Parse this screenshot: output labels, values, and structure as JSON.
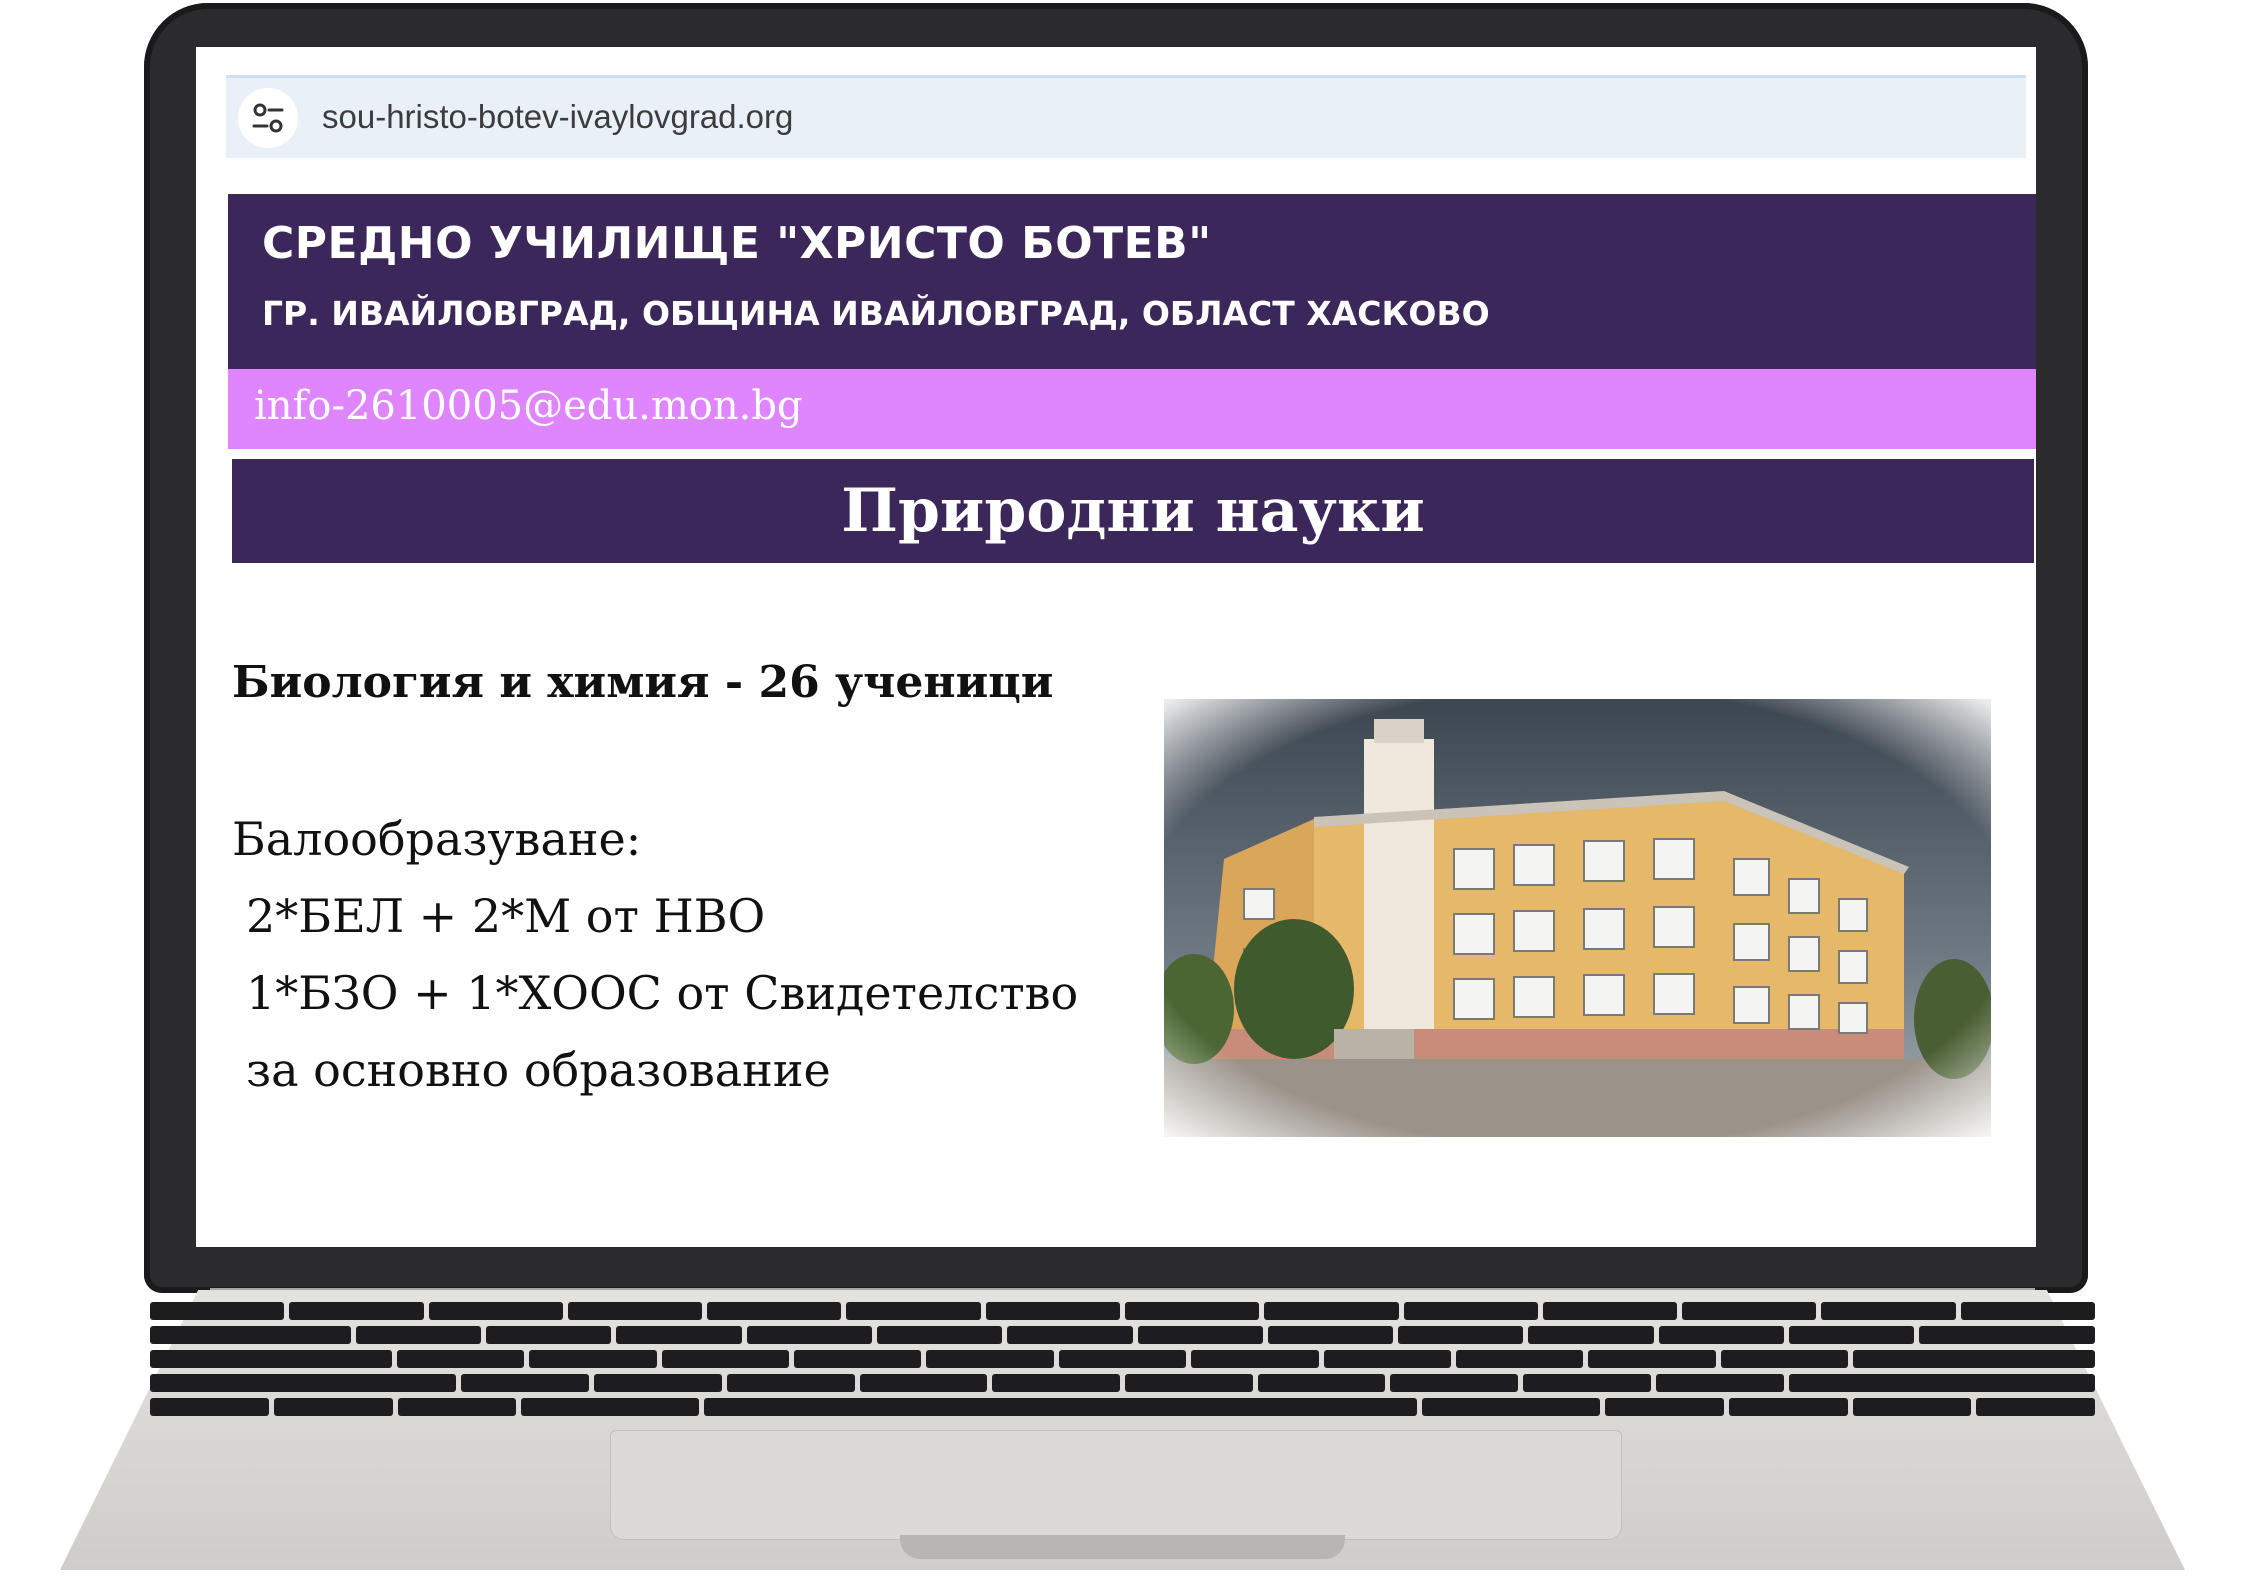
{
  "browser": {
    "url": "sou-hristo-botev-ivaylovgrad.org",
    "url_icon": "site-settings-icon"
  },
  "site": {
    "school_name": "СРЕДНО УЧИЛИЩЕ \"ХРИСТО БОТЕВ\"",
    "school_address": "ГР. ИВАЙЛОВГРАД, ОБЩИНА ИВАЙЛОВГРАД, ОБЛАСТ ХАСКОВО",
    "email": "info-2610005@edu.mon.bg",
    "page_title": "Природни науки"
  },
  "content": {
    "profile_heading": "Биология и химия - 26 ученици",
    "scoring_label": "Балообразуване:",
    "scoring_lines": [
      "2*БЕЛ + 2*М от НВО",
      "1*БЗО + 1*ХООС от Свидетелство",
      "за основно образование"
    ]
  },
  "colors": {
    "header_bg": "#3b2759",
    "email_bar_bg": "#df86ff",
    "title_bar_bg": "#3b2759",
    "url_bar_bg": "#eaf0f8"
  }
}
